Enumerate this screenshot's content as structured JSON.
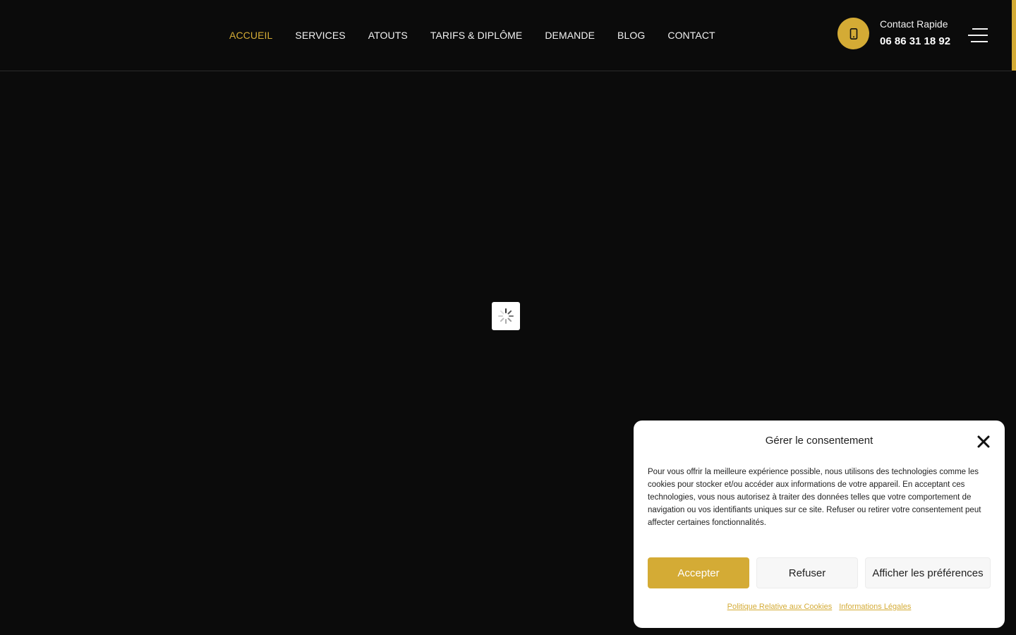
{
  "header": {
    "nav": [
      {
        "label": "ACCUEIL",
        "active": true
      },
      {
        "label": "SERVICES",
        "active": false
      },
      {
        "label": "ATOUTS",
        "active": false
      },
      {
        "label": "TARIFS & DIPLÔME",
        "active": false
      },
      {
        "label": "DEMANDE",
        "active": false
      },
      {
        "label": "BLOG",
        "active": false
      },
      {
        "label": "CONTACT",
        "active": false
      }
    ],
    "contact_label": "Contact Rapide",
    "contact_number": "06 86 31 18 92",
    "phone_icon": "mobile-phone-icon",
    "menu_icon": "hamburger-menu-icon"
  },
  "main": {
    "loading_icon": "loading-spinner-icon"
  },
  "cookie": {
    "title": "Gérer le consentement",
    "close_icon": "close-icon",
    "text": "Pour vous offrir la meilleure expérience possible, nous utilisons des technologies comme les cookies pour stocker et/ou accéder aux informations de votre appareil. En acceptant ces technologies, vous nous autorisez à traiter des données telles que votre comportement de navigation ou vos identifiants uniques sur ce site. Refuser ou retirer votre consentement peut affecter certaines fonctionnalités.",
    "accept_label": "Accepter",
    "refuse_label": "Refuser",
    "prefs_label": "Afficher les préférences",
    "link_policy": "Politique Relative aux Cookies",
    "link_legal": "Informations Légales"
  },
  "colors": {
    "background": "#0b0b0b",
    "accent": "#d4ab35",
    "text_light": "#f2f2f2"
  }
}
